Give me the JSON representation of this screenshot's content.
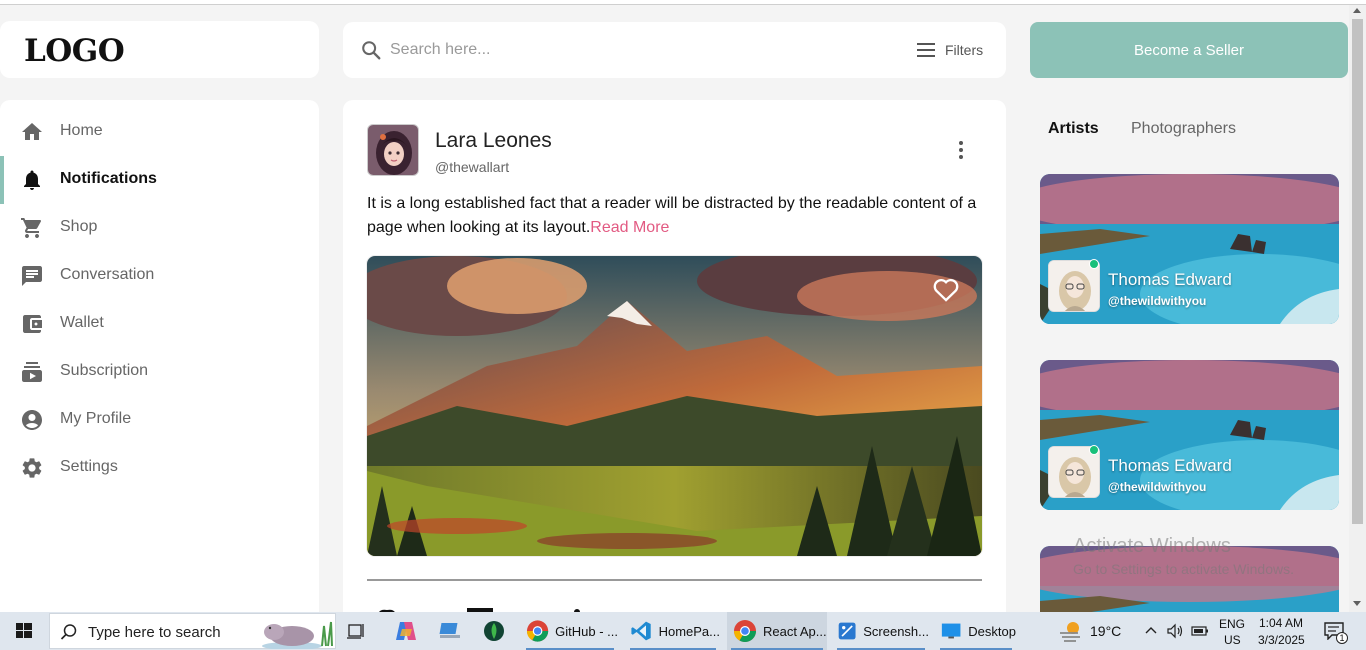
{
  "logo": {
    "text": "LOGO"
  },
  "sidebar": {
    "items": [
      {
        "label": "Home",
        "icon": "home-icon",
        "active": false
      },
      {
        "label": "Notifications",
        "icon": "bell-icon",
        "active": true
      },
      {
        "label": "Shop",
        "icon": "cart-icon",
        "active": false
      },
      {
        "label": "Conversation",
        "icon": "chat-icon",
        "active": false
      },
      {
        "label": "Wallet",
        "icon": "wallet-icon",
        "active": false
      },
      {
        "label": "Subscription",
        "icon": "subscription-icon",
        "active": false
      },
      {
        "label": "My Profile",
        "icon": "profile-icon",
        "active": false
      },
      {
        "label": "Settings",
        "icon": "gear-icon",
        "active": false
      }
    ]
  },
  "search": {
    "placeholder": "Search here...",
    "value": "",
    "filters_label": "Filters"
  },
  "seller_button": {
    "label": "Become a Seller"
  },
  "post": {
    "author_name": "Lara Leones",
    "author_handle": "@thewallart",
    "text": "It is a long established fact that a reader will be distracted by the readable content of a page when looking at its layout.",
    "read_more": "Read More"
  },
  "right_panel": {
    "tabs": [
      {
        "label": "Artists",
        "active": true
      },
      {
        "label": "Photographers",
        "active": false
      }
    ],
    "artists": [
      {
        "name": "Thomas Edward",
        "handle": "@thewildwithyou",
        "online": true
      },
      {
        "name": "Thomas Edward",
        "handle": "@thewildwithyou",
        "online": true
      }
    ]
  },
  "watermark": {
    "title": "Activate Windows",
    "subtitle": "Go to Settings to activate Windows."
  },
  "taskbar": {
    "search_placeholder": "Type here to search",
    "apps": [
      {
        "label": "GitHub - ...",
        "icon": "chrome-icon"
      },
      {
        "label": "HomePa...",
        "icon": "vscode-icon"
      },
      {
        "label": "React Ap...",
        "icon": "chrome-icon"
      },
      {
        "label": "Screensh...",
        "icon": "snip-icon"
      },
      {
        "label": "Desktop",
        "icon": "desktop-icon"
      }
    ],
    "weather": "19°C",
    "language": "ENG",
    "region": "US",
    "time": "1:04 AM",
    "date": "3/3/2025",
    "notification_count": "1"
  },
  "colors": {
    "accent": "#8cc2b7",
    "link": "#e25a82",
    "online": "#19c07a"
  }
}
